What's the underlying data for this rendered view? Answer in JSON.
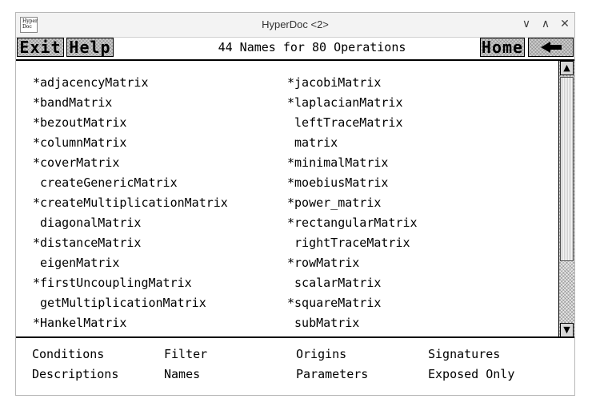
{
  "window": {
    "title": "HyperDoc <2>",
    "icon_lines": [
      "Hyper",
      "Doc"
    ],
    "controls": {
      "minimize": "∨",
      "maximize": "∧",
      "close": "✕"
    }
  },
  "toolbar": {
    "exit_label": "Exit",
    "help_label": "Help",
    "title": "44 Names for 80 Operations",
    "home_label": "Home",
    "back_icon": "back-arrow-icon"
  },
  "names_left": [
    "*adjacencyMatrix",
    "*bandMatrix",
    "*bezoutMatrix",
    "*columnMatrix",
    "*coverMatrix",
    " createGenericMatrix",
    "*createMultiplicationMatrix",
    " diagonalMatrix",
    "*distanceMatrix",
    " eigenMatrix",
    "*firstUncouplingMatrix",
    " getMultiplicationMatrix",
    "*HankelMatrix"
  ],
  "names_right": [
    "*jacobiMatrix",
    "*laplacianMatrix",
    " leftTraceMatrix",
    " matrix",
    "*minimalMatrix",
    "*moebiusMatrix",
    "*power_matrix",
    "*rectangularMatrix",
    " rightTraceMatrix",
    "*rowMatrix",
    " scalarMatrix",
    "*squareMatrix",
    " subMatrix"
  ],
  "scrollbar": {
    "up_icon": "▲",
    "down_icon": "▼"
  },
  "bottom_links": {
    "conditions": "Conditions",
    "filter": "Filter",
    "origins": "Origins",
    "signatures": "Signatures",
    "descriptions": "Descriptions",
    "names": "Names",
    "parameters": "Parameters",
    "exposed_only": "Exposed Only"
  }
}
